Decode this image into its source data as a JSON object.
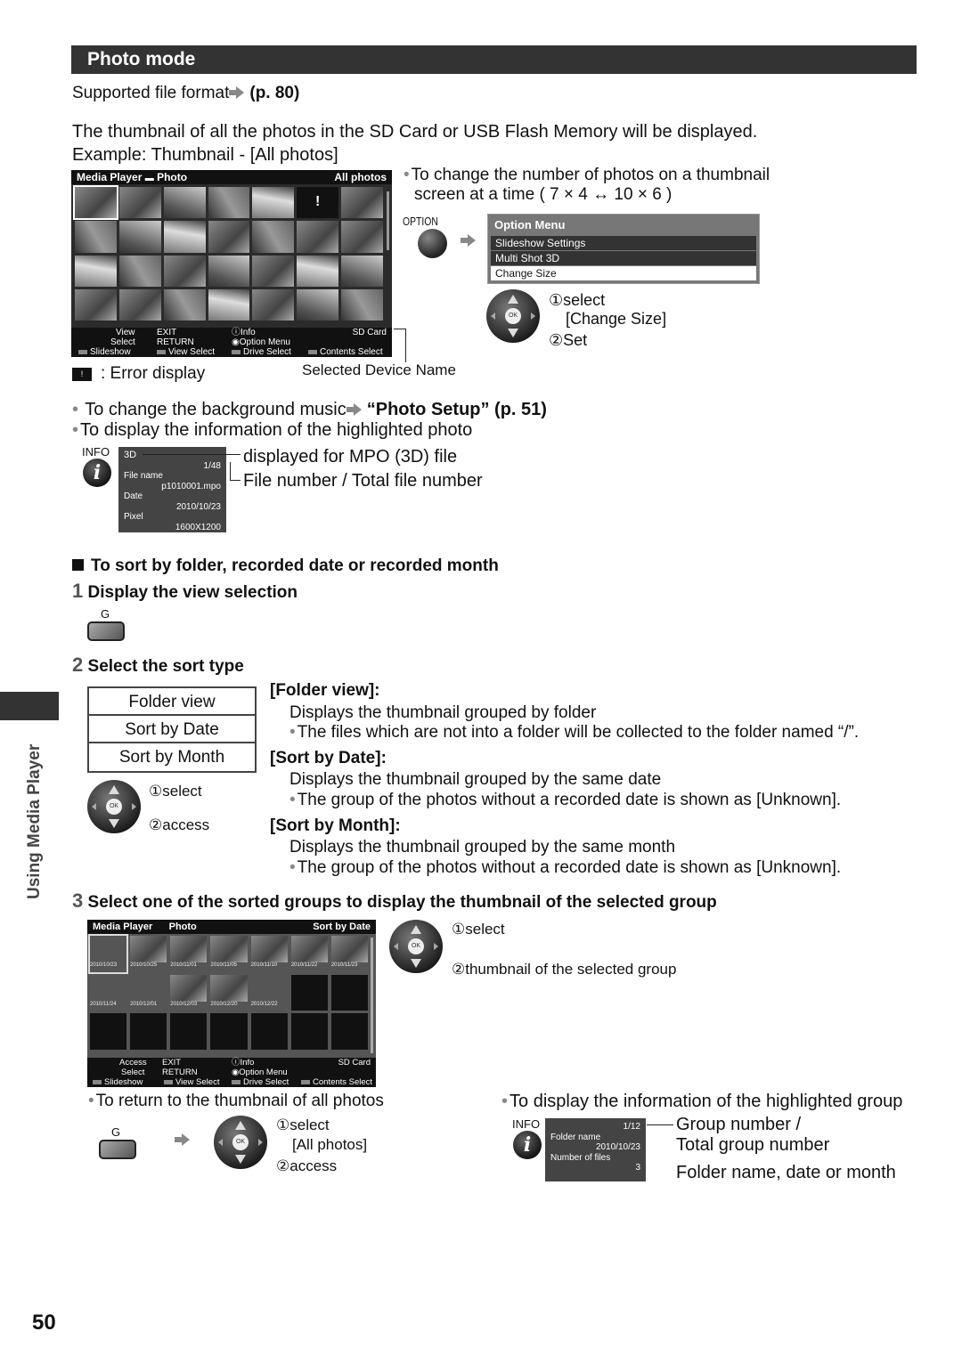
{
  "section_title": "Photo mode",
  "supported_format": {
    "text": "Supported file format",
    "ref": "(p. 80)"
  },
  "intro": {
    "line1": "The thumbnail of all the photos in the SD Card or USB Flash Memory will be displayed.",
    "line2": "Example: Thumbnail - [All photos]"
  },
  "screen1": {
    "app": "Media Player",
    "mode": "Photo",
    "view": "All photos",
    "device": "SD Card",
    "footer": {
      "view": "View",
      "select": "Select",
      "exit": "EXIT",
      "return": "RETURN",
      "info": "Info",
      "option_menu": "Option Menu",
      "slideshow": "Slideshow",
      "view_select": "View Select",
      "drive_select": "Drive Select",
      "contents_select": "Contents Select"
    },
    "grid": {
      "columns": 7,
      "rows": 4,
      "selected_index": 0,
      "error_index": 5
    }
  },
  "error_legend": ": Error display",
  "selected_device_label": "Selected Device Name",
  "thumbnail_size": {
    "text1": "To change the number of photos on a thumbnail",
    "text2": "screen at a time ( 7 × 4 ↔ 10 × 6 )",
    "option_label": "OPTION"
  },
  "option_menu": {
    "title": "Option Menu",
    "items": [
      "Slideshow Settings",
      "Multi Shot 3D",
      "Change Size"
    ],
    "selected": "Change Size"
  },
  "option_steps": {
    "step1": "①select",
    "step1b": "[Change Size]",
    "step2": "②Set"
  },
  "bg_music": {
    "text": "To change the background music",
    "ref": "“Photo Setup” (p. 51)"
  },
  "photo_info": {
    "text": "To display the information of the highlighted photo",
    "info_label": "INFO",
    "panel": {
      "tag": "3D",
      "count": "1/48",
      "file_label": "File name",
      "file": "p1010001.mpo",
      "date_label": "Date",
      "date": "2010/10/23",
      "pixel_label": "Pixel",
      "pixel": "1600X1200"
    },
    "callout1": "displayed for MPO (3D) file",
    "callout2": "File number / Total file number"
  },
  "sort_heading": "To sort by folder, recorded date or recorded month",
  "step1": {
    "num": "1",
    "text": "Display the view selection",
    "button": "G"
  },
  "step2": {
    "num": "2",
    "text": "Select the sort type"
  },
  "sort_options": [
    "Folder view",
    "Sort by Date",
    "Sort by Month"
  ],
  "step2_controls": {
    "select": "①select",
    "access": "②access"
  },
  "sort_descriptions": [
    {
      "title": "[Folder view]:",
      "desc": "Displays the thumbnail grouped by folder",
      "note": "The files which are not into a folder will be collected to the folder named “/”."
    },
    {
      "title": "[Sort by Date]:",
      "desc": "Displays the thumbnail grouped by the same date",
      "note": "The group of the photos without a recorded date is shown as [Unknown]."
    },
    {
      "title": "[Sort by Month]:",
      "desc": "Displays the thumbnail grouped by the same month",
      "note": "The group of the photos without a recorded date is shown as [Unknown]."
    }
  ],
  "step3": {
    "num": "3",
    "text": "Select one of the sorted groups to display the thumbnail of the selected group"
  },
  "screen2": {
    "app": "Media Player",
    "mode": "Photo",
    "view": "Sort by Date",
    "device": "SD Card",
    "groups": [
      "2010/10/23",
      "2010/10/25",
      "2010/11/01",
      "2010/11/05",
      "2010/11/10",
      "2010/11/22",
      "2010/11/23",
      "2010/11/24",
      "2010/12/01",
      "2010/12/03",
      "2010/12/20",
      "2010/12/22"
    ],
    "footer": {
      "access": "Access",
      "select": "Select",
      "exit": "EXIT",
      "return": "RETURN",
      "info": "Info",
      "option_menu": "Option Menu",
      "slideshow": "Slideshow",
      "view_select": "View Select",
      "drive_select": "Drive Select",
      "contents_select": "Contents Select"
    }
  },
  "step3_controls": {
    "select": "①select",
    "thumb": "②thumbnail of the selected group"
  },
  "return_all": {
    "text": "To return to the thumbnail of all photos",
    "button": "G",
    "select": "①select",
    "select_b": "[All photos]",
    "access": "②access"
  },
  "group_info": {
    "text": "To display the information of the highlighted group",
    "info_label": "INFO",
    "panel": {
      "count": "1/12",
      "folder_label": "Folder name",
      "folder": "2010/10/23",
      "files_label": "Number of files",
      "files": "3"
    },
    "callout1a": "Group number /",
    "callout1b": "Total group number",
    "callout2": "Folder name, date or month"
  },
  "side_label": "Using Media Player",
  "page_number": "50"
}
